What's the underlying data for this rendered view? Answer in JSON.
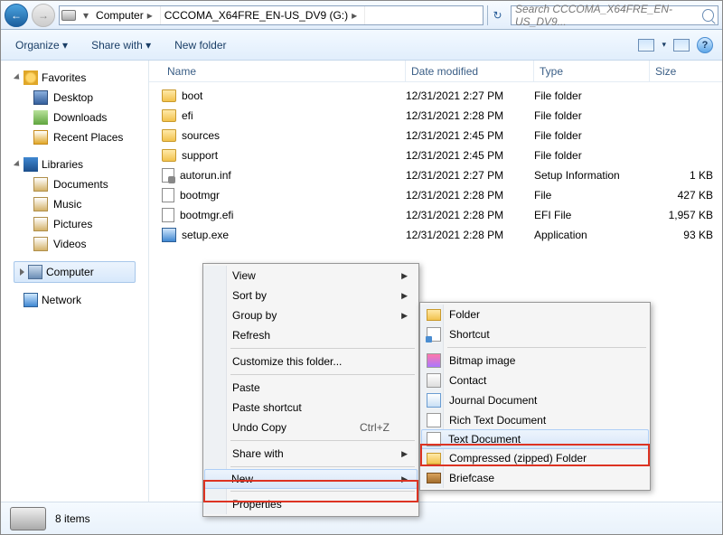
{
  "breadcrumb": {
    "dropdown": "▾",
    "segs": [
      "Computer",
      "CCCOMA_X64FRE_EN-US_DV9 (G:)"
    ]
  },
  "search": {
    "placeholder": "Search CCCOMA_X64FRE_EN-US_DV9..."
  },
  "toolbar": {
    "organize": "Organize ▾",
    "share": "Share with ▾",
    "newfolder": "New folder",
    "views_drop": "▾"
  },
  "nav": {
    "favorites": {
      "label": "Favorites",
      "items": [
        {
          "label": "Desktop"
        },
        {
          "label": "Downloads"
        },
        {
          "label": "Recent Places"
        }
      ]
    },
    "libraries": {
      "label": "Libraries",
      "items": [
        {
          "label": "Documents"
        },
        {
          "label": "Music"
        },
        {
          "label": "Pictures"
        },
        {
          "label": "Videos"
        }
      ]
    },
    "computer": {
      "label": "Computer"
    },
    "network": {
      "label": "Network"
    }
  },
  "columns": {
    "name": "Name",
    "date": "Date modified",
    "type": "Type",
    "size": "Size"
  },
  "files": [
    {
      "icon": "folder",
      "name": "boot",
      "date": "12/31/2021 2:27 PM",
      "type": "File folder",
      "size": ""
    },
    {
      "icon": "folder",
      "name": "efi",
      "date": "12/31/2021 2:28 PM",
      "type": "File folder",
      "size": ""
    },
    {
      "icon": "folder",
      "name": "sources",
      "date": "12/31/2021 2:45 PM",
      "type": "File folder",
      "size": ""
    },
    {
      "icon": "folder",
      "name": "support",
      "date": "12/31/2021 2:45 PM",
      "type": "File folder",
      "size": ""
    },
    {
      "icon": "ini",
      "name": "autorun.inf",
      "date": "12/31/2021 2:27 PM",
      "type": "Setup Information",
      "size": "1 KB"
    },
    {
      "icon": "file",
      "name": "bootmgr",
      "date": "12/31/2021 2:28 PM",
      "type": "File",
      "size": "427 KB"
    },
    {
      "icon": "file",
      "name": "bootmgr.efi",
      "date": "12/31/2021 2:28 PM",
      "type": "EFI File",
      "size": "1,957 KB"
    },
    {
      "icon": "exe",
      "name": "setup.exe",
      "date": "12/31/2021 2:28 PM",
      "type": "Application",
      "size": "93 KB"
    }
  ],
  "context": {
    "items": [
      {
        "label": "View",
        "submenu": true
      },
      {
        "label": "Sort by",
        "submenu": true
      },
      {
        "label": "Group by",
        "submenu": true
      },
      {
        "label": "Refresh"
      },
      {
        "sep": true
      },
      {
        "label": "Customize this folder..."
      },
      {
        "sep": true
      },
      {
        "label": "Paste"
      },
      {
        "label": "Paste shortcut"
      },
      {
        "label": "Undo Copy",
        "shortcut": "Ctrl+Z"
      },
      {
        "sep": true
      },
      {
        "label": "Share with",
        "submenu": true
      },
      {
        "sep": true
      },
      {
        "label": "New",
        "submenu": true,
        "highlight": true
      },
      {
        "sep": true
      },
      {
        "label": "Properties"
      }
    ]
  },
  "submenu_new": {
    "items": [
      {
        "icon": "folder",
        "label": "Folder"
      },
      {
        "icon": "sc",
        "label": "Shortcut"
      },
      {
        "sep": true
      },
      {
        "icon": "bmp",
        "label": "Bitmap image"
      },
      {
        "icon": "con",
        "label": "Contact"
      },
      {
        "icon": "jrn",
        "label": "Journal Document"
      },
      {
        "icon": "rtf",
        "label": "Rich Text Document"
      },
      {
        "icon": "txt",
        "label": "Text Document",
        "highlight": true
      },
      {
        "icon": "zip",
        "label": "Compressed (zipped) Folder"
      },
      {
        "icon": "brf",
        "label": "Briefcase"
      }
    ]
  },
  "status": {
    "text": "8 items"
  }
}
